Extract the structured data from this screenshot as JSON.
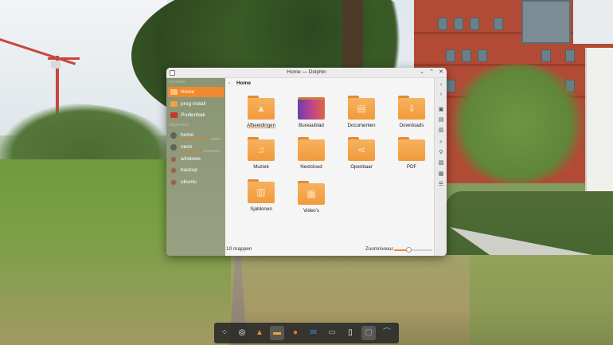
{
  "window": {
    "title": "Home — Dolphin",
    "buttons": {
      "minimize": "⌄",
      "maximize": "⌃",
      "close": "✕"
    }
  },
  "sidebar": {
    "sections": {
      "places": "Locaties",
      "devices": "Apparaten"
    },
    "places": [
      {
        "label": "Home",
        "icon": "home-folder-icon",
        "active": true
      },
      {
        "label": "prog install",
        "icon": "folder-icon",
        "active": false
      },
      {
        "label": "Prullenbak",
        "icon": "trash-icon",
        "active": false
      }
    ],
    "devices": [
      {
        "label": "home",
        "icon": "drive-icon",
        "usage": 0.75
      },
      {
        "label": "neon",
        "icon": "drive-icon",
        "usage": 0.55
      },
      {
        "label": "windows",
        "icon": "user-drive-icon"
      },
      {
        "label": "backup",
        "icon": "user-drive-icon"
      },
      {
        "label": "ubuntu",
        "icon": "user-drive-icon"
      }
    ]
  },
  "breadcrumb": {
    "chevron": "›",
    "current": "Home"
  },
  "files": [
    {
      "label": "Afbeeldingen",
      "glyph": "▲",
      "icon": "pictures-folder-icon",
      "selected": true
    },
    {
      "label": "Bureaublad",
      "glyph": "",
      "icon": "desktop-folder-icon",
      "selected": false
    },
    {
      "label": "Documenten",
      "glyph": "▤",
      "icon": "documents-folder-icon",
      "selected": false
    },
    {
      "label": "Downloads",
      "glyph": "⇓",
      "icon": "downloads-folder-icon",
      "selected": false
    },
    {
      "label": "Muziek",
      "glyph": "♫",
      "icon": "music-folder-icon",
      "selected": false
    },
    {
      "label": "Nextcloud",
      "glyph": "",
      "icon": "nextcloud-folder-icon",
      "selected": false
    },
    {
      "label": "Openbaar",
      "glyph": "⋖",
      "icon": "public-folder-icon",
      "selected": false
    },
    {
      "label": "PDF",
      "glyph": "",
      "icon": "pdf-folder-icon",
      "selected": false
    },
    {
      "label": "Sjablonen",
      "glyph": "▥",
      "icon": "templates-folder-icon",
      "selected": false
    },
    {
      "label": "Video's",
      "glyph": "▦",
      "icon": "videos-folder-icon",
      "selected": false
    }
  ],
  "status": {
    "count": "10 mappen",
    "zoom_label": "Zoomniveau:",
    "zoom_level": 0.38
  },
  "tools": [
    "‹",
    "›",
    "▣",
    "▤",
    "▥",
    "⌕",
    "⚲",
    "▧",
    "▦",
    "☰"
  ],
  "dock": [
    {
      "name": "launcher-icon",
      "glyph": "⁘"
    },
    {
      "name": "settings-icon",
      "glyph": "◎"
    },
    {
      "name": "software-store-icon",
      "glyph": "▲"
    },
    {
      "name": "file-manager-icon",
      "glyph": "▬",
      "active": true
    },
    {
      "name": "firefox-icon",
      "glyph": "●"
    },
    {
      "name": "thunderbird-icon",
      "glyph": "✉"
    },
    {
      "name": "terminal-icon",
      "glyph": "▭"
    },
    {
      "name": "text-editor-icon",
      "glyph": "▯"
    },
    {
      "name": "window-switcher-icon",
      "glyph": "▢",
      "active": true
    },
    {
      "name": "system-monitor-icon",
      "glyph": "⌒"
    }
  ],
  "colors": {
    "accent": "#f08a2e",
    "folder": "#f5a041",
    "sidebar": "#8f9a7a"
  }
}
